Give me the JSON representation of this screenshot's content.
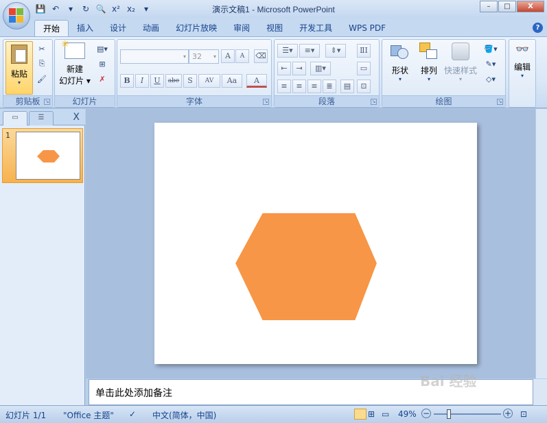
{
  "window": {
    "title": "演示文稿1 - Microsoft PowerPoint",
    "minimize": "–",
    "maximize": "□",
    "close": "X"
  },
  "ribbon_tabs": [
    "开始",
    "插入",
    "设计",
    "动画",
    "幻灯片放映",
    "审阅",
    "视图",
    "开发工具",
    "WPS PDF"
  ],
  "active_tab": "开始",
  "help_label": "?",
  "groups": {
    "clipboard": {
      "label": "剪贴板",
      "paste": "粘贴"
    },
    "slides": {
      "label": "幻灯片",
      "new_slide_line1": "新建",
      "new_slide_line2": "幻灯片"
    },
    "font": {
      "label": "字体",
      "font_size": "32",
      "bold": "B",
      "italic": "I",
      "underline": "U",
      "strike": "abe",
      "shadow": "S",
      "spacing": "AV",
      "case": "Aa",
      "grow": "A",
      "shrink": "A",
      "color": "A"
    },
    "paragraph": {
      "label": "段落"
    },
    "drawing": {
      "label": "绘图",
      "shapes": "形状",
      "arrange": "排列",
      "quick_styles": "快速样式"
    },
    "editing": {
      "label": "编辑"
    }
  },
  "slide_panel": {
    "slide_number": "1",
    "close": "X"
  },
  "notes": {
    "placeholder": "单击此处添加备注"
  },
  "status": {
    "slide_info": "幻灯片 1/1",
    "theme": "\"Office 主题\"",
    "language": "中文(简体，中国)",
    "zoom": "49%"
  },
  "watermark": "Bai 经验",
  "shape": {
    "type": "hexagon",
    "fill": "#f79646",
    "outline": "#ffffff"
  },
  "colors": {
    "accent": "#f79646",
    "ribbon": "#dbe8f7",
    "status": "#c5d9f1"
  }
}
